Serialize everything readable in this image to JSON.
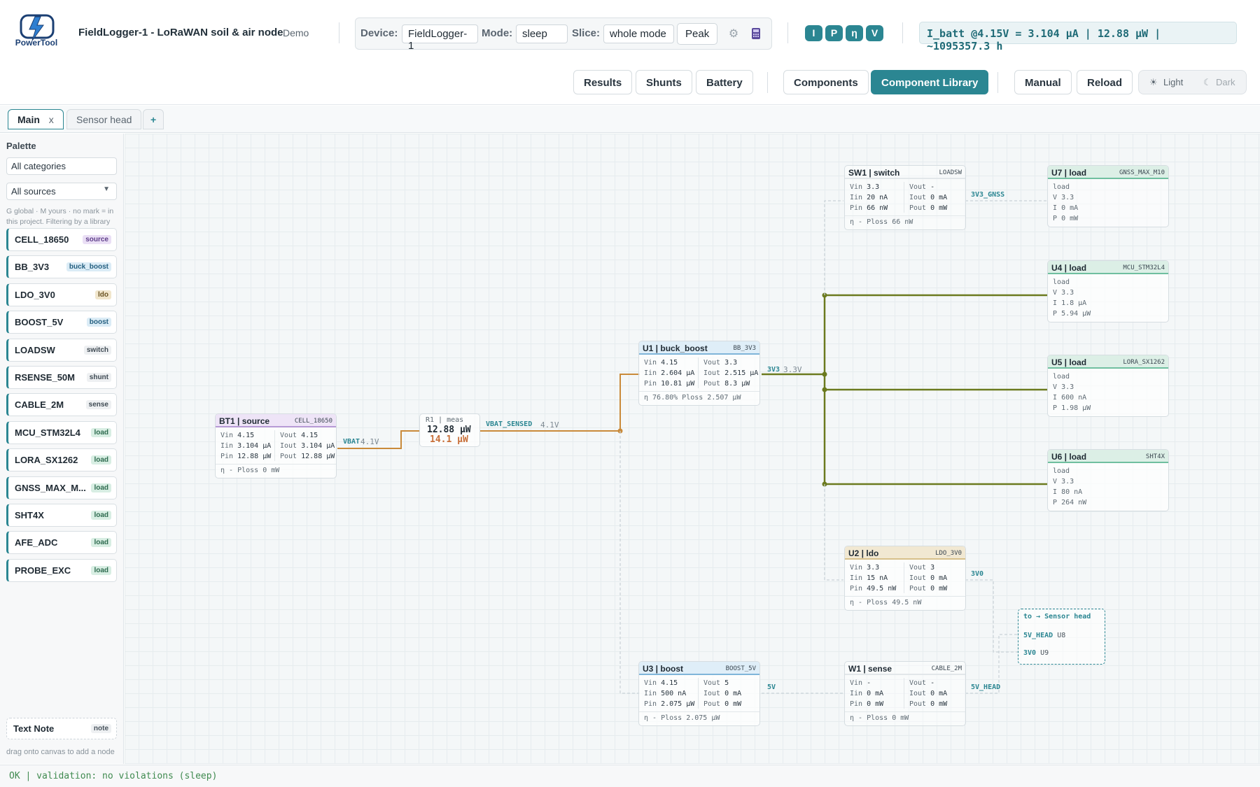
{
  "app": {
    "logo_text": "PowerTool",
    "title": "FieldLogger-1 - LoRaWAN soil & air node",
    "badge": "Demo"
  },
  "device_bar": {
    "device_label": "Device:",
    "device_value": "FieldLogger-1",
    "mode_label": "Mode:",
    "mode_value": "sleep",
    "slice_label": "Slice:",
    "slice_value": "whole mode",
    "peak_label": "Peak",
    "settings_icon": "gear-icon",
    "calc_icon": "calculator-icon"
  },
  "pills": [
    "I",
    "P",
    "η",
    "V"
  ],
  "readout": "I_batt @4.15V = 3.104 μA | 12.88 μW | ~1095357.3 h",
  "nav": {
    "results": "Results",
    "shunts": "Shunts",
    "battery": "Battery",
    "components": "Components",
    "component_library": "Component Library",
    "manual": "Manual",
    "reload": "Reload",
    "light": "Light",
    "dark": "Dark"
  },
  "tabs": {
    "main": "Main",
    "main_close": "x",
    "sensor_head": "Sensor head",
    "add": "+"
  },
  "palette": {
    "title": "Palette",
    "category_filter": "All categories",
    "source_filter": "All sources",
    "hint": "G global · M yours · no mark = in this project. Filtering by a library also finds the copies this project took from it.",
    "items": [
      {
        "name": "CELL_18650",
        "tag": "source"
      },
      {
        "name": "BB_3V3",
        "tag": "buck_boost"
      },
      {
        "name": "LDO_3V0",
        "tag": "ldo"
      },
      {
        "name": "BOOST_5V",
        "tag": "boost"
      },
      {
        "name": "LOADSW",
        "tag": "switch"
      },
      {
        "name": "RSENSE_50M",
        "tag": "shunt"
      },
      {
        "name": "CABLE_2M",
        "tag": "sense"
      },
      {
        "name": "MCU_STM32L4",
        "tag": "load"
      },
      {
        "name": "LORA_SX1262",
        "tag": "load"
      },
      {
        "name": "GNSS_MAX_M...",
        "tag": "load"
      },
      {
        "name": "SHT4X",
        "tag": "load"
      },
      {
        "name": "AFE_ADC",
        "tag": "load"
      },
      {
        "name": "PROBE_EXC",
        "tag": "load"
      }
    ],
    "note_name": "Text Note",
    "note_tag": "note",
    "drag_hint": "drag onto canvas to add a node"
  },
  "nodes": {
    "bt1": {
      "name": "BT1 | source",
      "lib": "CELL_18650",
      "vin": "4.15",
      "iin": "3.104 μA",
      "pin": "12.88 μW",
      "vout": "4.15",
      "iout": "3.104 μA",
      "pout": "12.88 μW",
      "foot": "η - Ploss 0 mW"
    },
    "r1": {
      "name": "R1 | meas",
      "p1": "12.88 μW",
      "p2": "14.1 μW"
    },
    "u1": {
      "name": "U1 | buck_boost",
      "lib": "BB_3V3",
      "vin": "4.15",
      "iin": "2.604 μA",
      "pin": "10.81 μW",
      "vout": "3.3",
      "iout": "2.515 μA",
      "pout": "8.3 μW",
      "foot": "η 76.80% Ploss 2.507 μW"
    },
    "sw1": {
      "name": "SW1 | switch",
      "lib": "LOADSW",
      "vin": "3.3",
      "iin": "20 nA",
      "pin": "66 nW",
      "vout": "-",
      "iout": "0 mA",
      "pout": "0 mW",
      "foot": "η - Ploss 66 nW"
    },
    "u2": {
      "name": "U2 | ldo",
      "lib": "LDO_3V0",
      "vin": "3.3",
      "iin": "15 nA",
      "pin": "49.5 nW",
      "vout": "3",
      "iout": "0 mA",
      "pout": "0 mW",
      "foot": "η - Ploss 49.5 nW"
    },
    "u3": {
      "name": "U3 | boost",
      "lib": "BOOST_5V",
      "vin": "4.15",
      "iin": "500 nA",
      "pin": "2.075 μW",
      "vout": "5",
      "iout": "0 mA",
      "pout": "0 mW",
      "foot": "η - Ploss 2.075 μW"
    },
    "w1": {
      "name": "W1 | sense",
      "lib": "CABLE_2M",
      "vin": "-",
      "iin": "0 mA",
      "pin": "0 mW",
      "vout": "-",
      "iout": "0 mA",
      "pout": "0 mW",
      "foot": "η - Ploss 0 mW"
    },
    "u7": {
      "name": "U7 | load",
      "lib": "GNSS_MAX_M10",
      "kind": "load",
      "v": "3.3",
      "i": "0 mA",
      "p": "0 mW"
    },
    "u4": {
      "name": "U4 | load",
      "lib": "MCU_STM32L4",
      "kind": "load",
      "v": "3.3",
      "i": "1.8 μA",
      "p": "5.94 μW"
    },
    "u5": {
      "name": "U5 | load",
      "lib": "LORA_SX1262",
      "kind": "load",
      "v": "3.3",
      "i": "600 nA",
      "p": "1.98 μW"
    },
    "u6": {
      "name": "U6 | load",
      "lib": "SHT4X",
      "kind": "load",
      "v": "3.3",
      "i": "80 nA",
      "p": "264 nW"
    }
  },
  "nets": {
    "vbat": "VBAT",
    "vbat_v": "4.1V",
    "vbat_sensed": "VBAT_SENSED",
    "vbat_sensed_v": "4.1V",
    "n3v3": "3V3",
    "n3v3_v": "3.3V",
    "n3v3_gnss": "3V3_GNSS",
    "n3v0": "3V0",
    "n5v": "5V",
    "n5v_head": "5V_HEAD"
  },
  "offpage": {
    "title": "to → Sensor head",
    "row1_net": "5V_HEAD",
    "row1_ref": "U8",
    "row2_net": "3V0",
    "row2_ref": "U9"
  },
  "labels": {
    "vin": "Vin",
    "iin": "Iin",
    "pin": "Pin",
    "vout": "Vout",
    "iout": "Iout",
    "pout": "Pout",
    "v": "V",
    "i": "I",
    "p": "P"
  },
  "status": "OK | validation: no violations (sleep)",
  "colors": {
    "accent": "#2b8692",
    "wire_battery": "#c98a3a",
    "wire_3v3": "#6b7a1e",
    "source": "#b79ad6",
    "buck_boost": "#7fb5d9",
    "load": "#6fbf9f",
    "ldo": "#d7c08a"
  }
}
